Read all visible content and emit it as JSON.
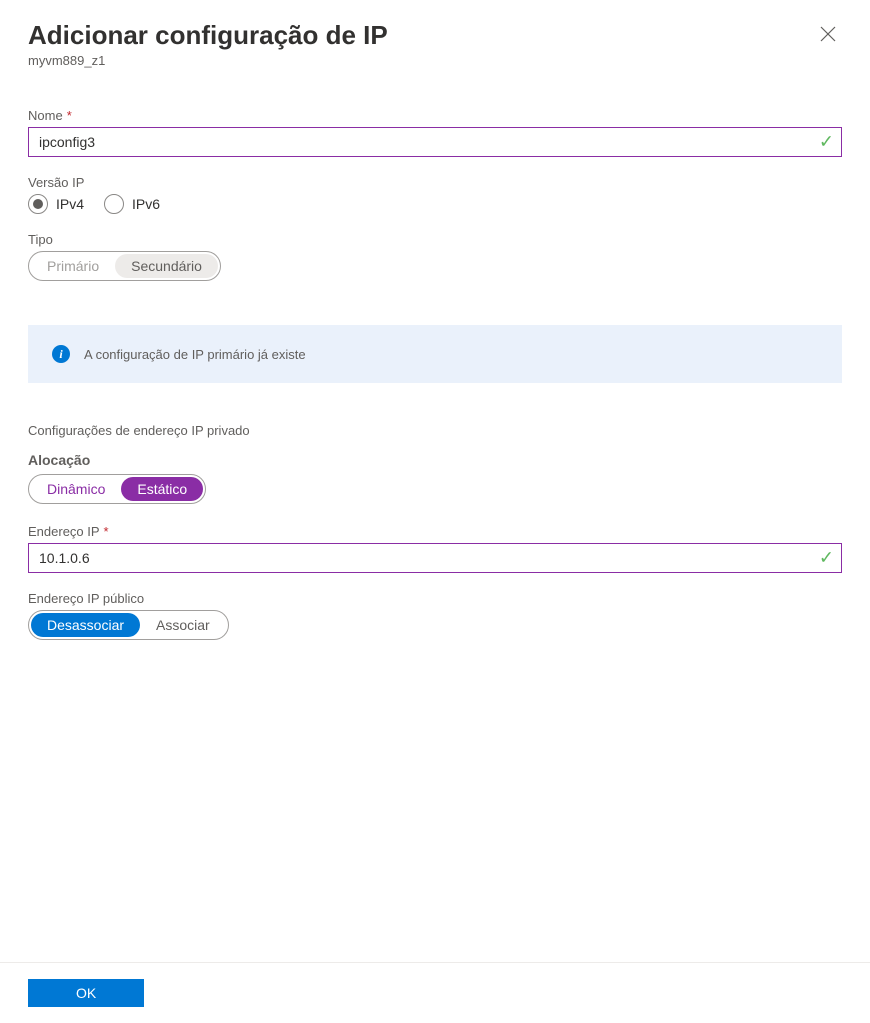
{
  "header": {
    "title": "Adicionar configuração de IP",
    "subtitle": "myvm889_z1"
  },
  "fields": {
    "name": {
      "label": "Nome",
      "value": "ipconfig3",
      "required": true,
      "valid": true
    },
    "ip_version": {
      "label": "Versão IP",
      "options": {
        "v4": "IPv4",
        "v6": "IPv6"
      },
      "selected": "v4"
    },
    "type": {
      "label": "Tipo",
      "options": {
        "primary": "Primário",
        "secondary": "Secundário"
      },
      "selected": "secondary"
    },
    "private_section": "Configurações de endereço IP privado",
    "allocation": {
      "label": "Alocação",
      "options": {
        "dynamic": "Dinâmico",
        "static": "Estático"
      },
      "selected": "static"
    },
    "ip_address": {
      "label": "Endereço IP",
      "value": "10.1.0.6",
      "required": true,
      "valid": true
    },
    "public_ip": {
      "label": "Endereço IP público",
      "options": {
        "disassociate": "Desassociar",
        "associate": "Associar"
      },
      "selected": "disassociate"
    }
  },
  "info": {
    "message": "A configuração de IP primário já existe"
  },
  "footer": {
    "ok": "OK"
  }
}
